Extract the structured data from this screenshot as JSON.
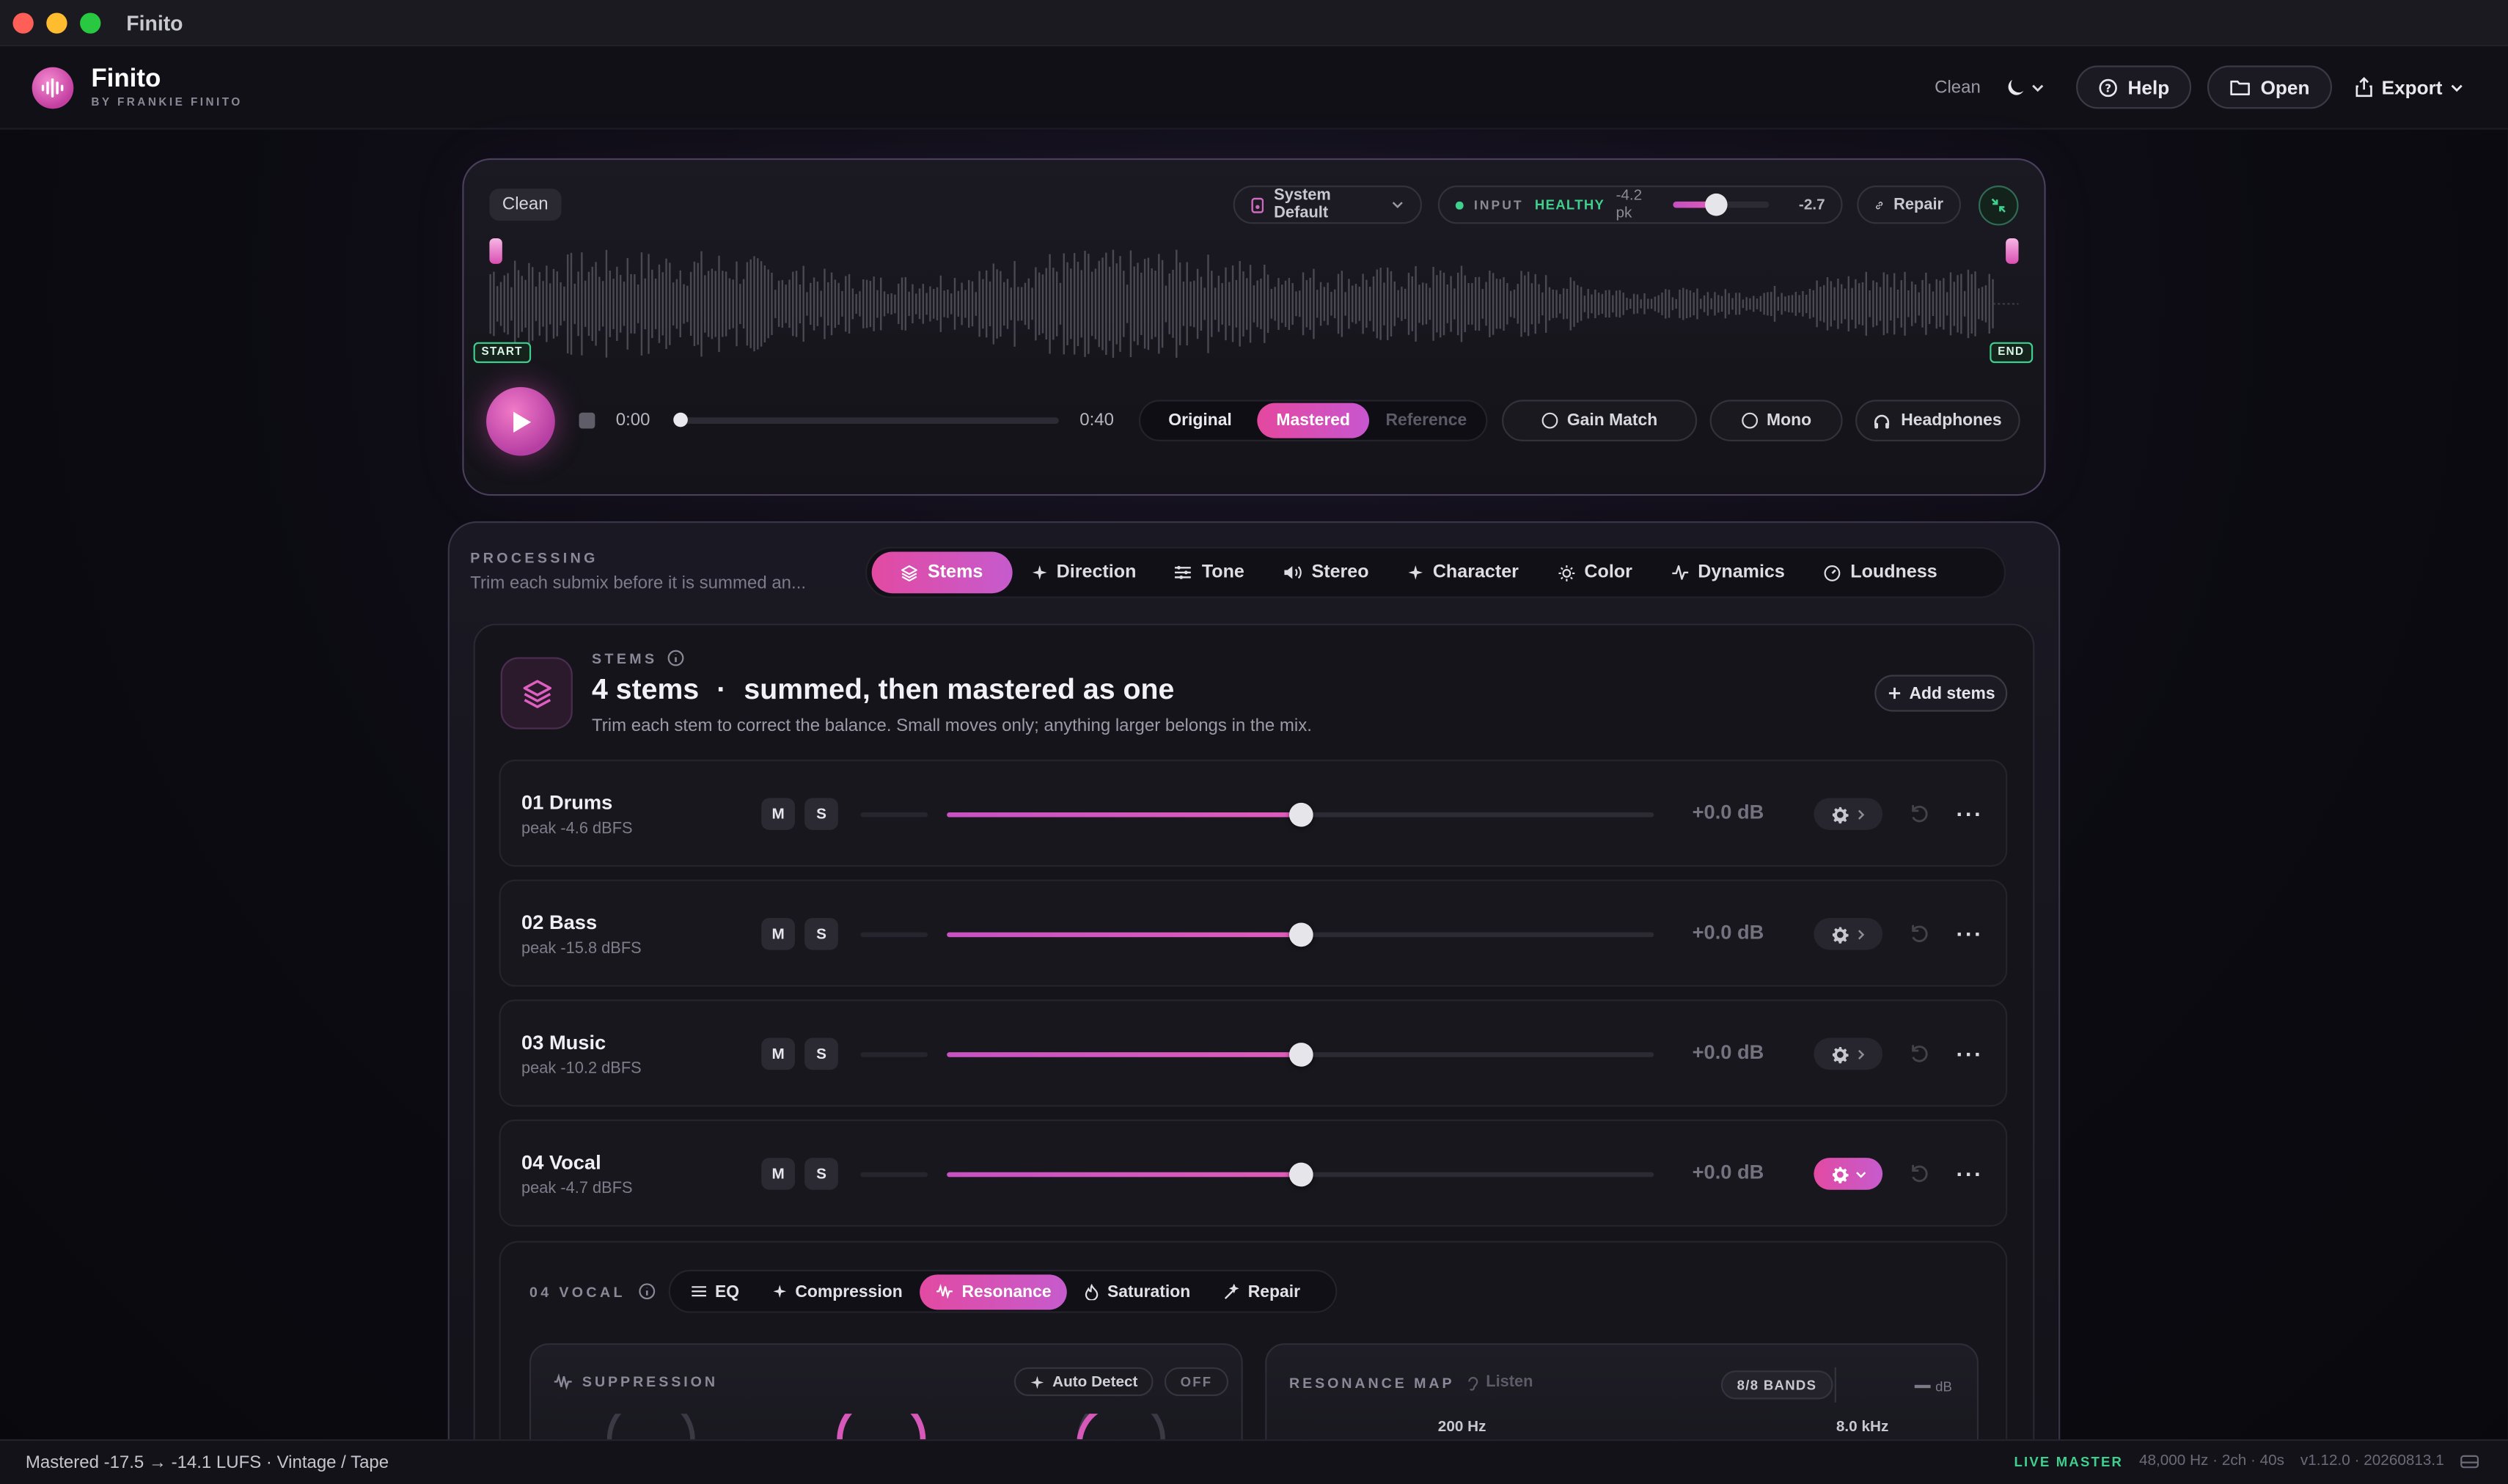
{
  "window": {
    "title": "Finito"
  },
  "header": {
    "brand": "Finito",
    "byline": "BY FRANKIE FINITO",
    "preset": "Clean",
    "help": "Help",
    "open": "Open",
    "export": "Export"
  },
  "player": {
    "preset_chip": "Clean",
    "output_device": "System Default",
    "input_label": "INPUT",
    "input_status": "HEALTHY",
    "input_peak": "-4.2 pk",
    "input_gain": "-2.7",
    "input_gain_fraction": 0.45,
    "repair": "Repair",
    "start_label": "START",
    "end_label": "END",
    "time_current": "0:00",
    "time_total": "0:40",
    "progress_fraction": 0.0,
    "modes": [
      "Original",
      "Mastered",
      "Reference"
    ],
    "active_mode": "Mastered",
    "gain_match": "Gain Match",
    "mono": "Mono",
    "headphones": "Headphones"
  },
  "processing": {
    "label": "PROCESSING",
    "description": "Trim each submix before it is summed an...",
    "tabs": [
      {
        "label": "Stems",
        "icon": "layers-icon"
      },
      {
        "label": "Direction",
        "icon": "sparkle-icon"
      },
      {
        "label": "Tone",
        "icon": "sliders-icon"
      },
      {
        "label": "Stereo",
        "icon": "speaker-icon"
      },
      {
        "label": "Character",
        "icon": "sparkle-icon"
      },
      {
        "label": "Color",
        "icon": "sun-icon"
      },
      {
        "label": "Dynamics",
        "icon": "pulse-icon"
      },
      {
        "label": "Loudness",
        "icon": "gauge-icon"
      }
    ],
    "active_tab": "Stems"
  },
  "stems": {
    "label": "STEMS",
    "count_title": "4 stems",
    "title_sep": "·",
    "title_rest": "summed, then mastered as one",
    "subtitle": "Trim each stem to correct the balance. Small moves only; anything larger belongs in the mix.",
    "add_button": "Add stems",
    "mute_label": "M",
    "solo_label": "S",
    "rows": [
      {
        "name": "01 Drums",
        "peak": "peak -4.6 dBFS",
        "gain": "+0.0 dB",
        "fader_fraction": 0.5,
        "settings_open": false
      },
      {
        "name": "02 Bass",
        "peak": "peak -15.8 dBFS",
        "gain": "+0.0 dB",
        "fader_fraction": 0.5,
        "settings_open": false
      },
      {
        "name": "03 Music",
        "peak": "peak -10.2 dBFS",
        "gain": "+0.0 dB",
        "fader_fraction": 0.5,
        "settings_open": false
      },
      {
        "name": "04 Vocal",
        "peak": "peak -4.7 dBFS",
        "gain": "+0.0 dB",
        "fader_fraction": 0.5,
        "settings_open": true
      }
    ]
  },
  "stem_detail": {
    "label": "04 VOCAL",
    "tabs": [
      {
        "label": "EQ",
        "icon": "sliders-icon"
      },
      {
        "label": "Compression",
        "icon": "sparkle-icon"
      },
      {
        "label": "Resonance",
        "icon": "wave-icon"
      },
      {
        "label": "Saturation",
        "icon": "flame-icon"
      },
      {
        "label": "Repair",
        "icon": "wand-icon"
      }
    ],
    "active_tab": "Resonance",
    "suppression": {
      "label": "SUPPRESSION",
      "auto_detect": "Auto Detect",
      "state": "OFF"
    },
    "resonance_map": {
      "label": "RESONANCE MAP",
      "listen": "Listen",
      "bands": "8/8 BANDS",
      "unit": "dB",
      "freq_low": "200 Hz",
      "freq_high": "8.0 kHz"
    }
  },
  "status": {
    "left": "Mastered  -17.5 → -14.1 LUFS · Vintage / Tape",
    "live": "LIVE MASTER",
    "format": "48,000 Hz · 2ch · 40s",
    "version": "v1.12.0 · 20260813.1"
  }
}
